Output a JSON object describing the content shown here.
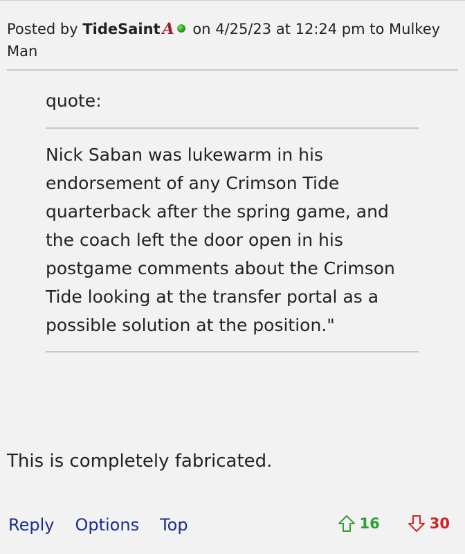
{
  "post": {
    "posted_by_prefix": "Posted by",
    "author": "TideSaint",
    "team_logo_glyph": "A",
    "posted_on_text": "on 4/25/23 at 12:24 pm to Mulkey Man"
  },
  "quote": {
    "label": "quote:",
    "text": "Nick Saban was lukewarm in his endorsement of any Crimson Tide quarterback after the spring game, and the coach left the door open in his postgame comments about the Crimson Tide looking at the transfer portal as a possible solution at the position.\""
  },
  "body": {
    "text": "This is completely fabricated."
  },
  "actions": {
    "reply": "Reply",
    "options": "Options",
    "top": "Top"
  },
  "votes": {
    "up_count": "16",
    "down_count": "30",
    "up_color": "#2e9e2e",
    "down_color": "#d42020"
  },
  "icons": {
    "team_logo": "alabama-script-a-icon",
    "online_status": "online-dot-icon",
    "upvote": "arrow-up-icon",
    "downvote": "arrow-down-icon"
  }
}
